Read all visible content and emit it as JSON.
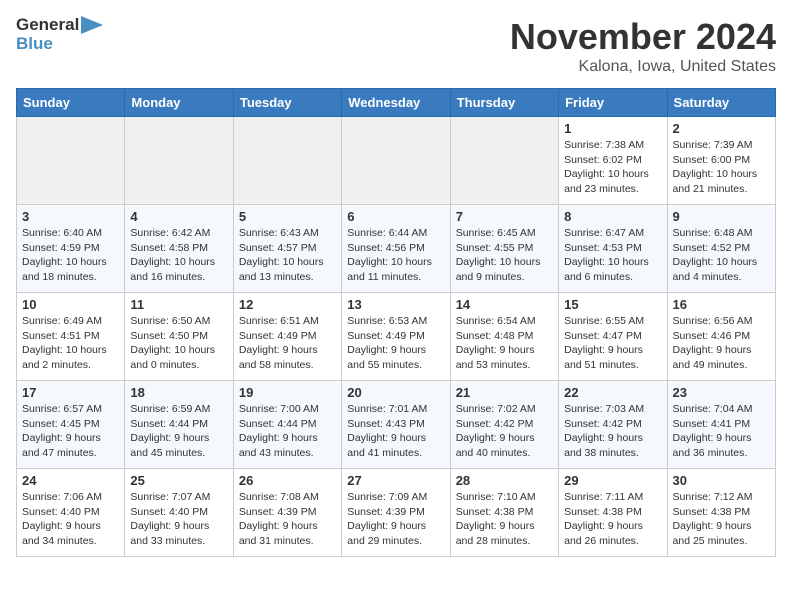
{
  "logo": {
    "line1": "General",
    "line2": "Blue"
  },
  "title": "November 2024",
  "subtitle": "Kalona, Iowa, United States",
  "days_of_week": [
    "Sunday",
    "Monday",
    "Tuesday",
    "Wednesday",
    "Thursday",
    "Friday",
    "Saturday"
  ],
  "weeks": [
    [
      {
        "day": "",
        "info": ""
      },
      {
        "day": "",
        "info": ""
      },
      {
        "day": "",
        "info": ""
      },
      {
        "day": "",
        "info": ""
      },
      {
        "day": "",
        "info": ""
      },
      {
        "day": "1",
        "info": "Sunrise: 7:38 AM\nSunset: 6:02 PM\nDaylight: 10 hours and 23 minutes."
      },
      {
        "day": "2",
        "info": "Sunrise: 7:39 AM\nSunset: 6:00 PM\nDaylight: 10 hours and 21 minutes."
      }
    ],
    [
      {
        "day": "3",
        "info": "Sunrise: 6:40 AM\nSunset: 4:59 PM\nDaylight: 10 hours and 18 minutes."
      },
      {
        "day": "4",
        "info": "Sunrise: 6:42 AM\nSunset: 4:58 PM\nDaylight: 10 hours and 16 minutes."
      },
      {
        "day": "5",
        "info": "Sunrise: 6:43 AM\nSunset: 4:57 PM\nDaylight: 10 hours and 13 minutes."
      },
      {
        "day": "6",
        "info": "Sunrise: 6:44 AM\nSunset: 4:56 PM\nDaylight: 10 hours and 11 minutes."
      },
      {
        "day": "7",
        "info": "Sunrise: 6:45 AM\nSunset: 4:55 PM\nDaylight: 10 hours and 9 minutes."
      },
      {
        "day": "8",
        "info": "Sunrise: 6:47 AM\nSunset: 4:53 PM\nDaylight: 10 hours and 6 minutes."
      },
      {
        "day": "9",
        "info": "Sunrise: 6:48 AM\nSunset: 4:52 PM\nDaylight: 10 hours and 4 minutes."
      }
    ],
    [
      {
        "day": "10",
        "info": "Sunrise: 6:49 AM\nSunset: 4:51 PM\nDaylight: 10 hours and 2 minutes."
      },
      {
        "day": "11",
        "info": "Sunrise: 6:50 AM\nSunset: 4:50 PM\nDaylight: 10 hours and 0 minutes."
      },
      {
        "day": "12",
        "info": "Sunrise: 6:51 AM\nSunset: 4:49 PM\nDaylight: 9 hours and 58 minutes."
      },
      {
        "day": "13",
        "info": "Sunrise: 6:53 AM\nSunset: 4:49 PM\nDaylight: 9 hours and 55 minutes."
      },
      {
        "day": "14",
        "info": "Sunrise: 6:54 AM\nSunset: 4:48 PM\nDaylight: 9 hours and 53 minutes."
      },
      {
        "day": "15",
        "info": "Sunrise: 6:55 AM\nSunset: 4:47 PM\nDaylight: 9 hours and 51 minutes."
      },
      {
        "day": "16",
        "info": "Sunrise: 6:56 AM\nSunset: 4:46 PM\nDaylight: 9 hours and 49 minutes."
      }
    ],
    [
      {
        "day": "17",
        "info": "Sunrise: 6:57 AM\nSunset: 4:45 PM\nDaylight: 9 hours and 47 minutes."
      },
      {
        "day": "18",
        "info": "Sunrise: 6:59 AM\nSunset: 4:44 PM\nDaylight: 9 hours and 45 minutes."
      },
      {
        "day": "19",
        "info": "Sunrise: 7:00 AM\nSunset: 4:44 PM\nDaylight: 9 hours and 43 minutes."
      },
      {
        "day": "20",
        "info": "Sunrise: 7:01 AM\nSunset: 4:43 PM\nDaylight: 9 hours and 41 minutes."
      },
      {
        "day": "21",
        "info": "Sunrise: 7:02 AM\nSunset: 4:42 PM\nDaylight: 9 hours and 40 minutes."
      },
      {
        "day": "22",
        "info": "Sunrise: 7:03 AM\nSunset: 4:42 PM\nDaylight: 9 hours and 38 minutes."
      },
      {
        "day": "23",
        "info": "Sunrise: 7:04 AM\nSunset: 4:41 PM\nDaylight: 9 hours and 36 minutes."
      }
    ],
    [
      {
        "day": "24",
        "info": "Sunrise: 7:06 AM\nSunset: 4:40 PM\nDaylight: 9 hours and 34 minutes."
      },
      {
        "day": "25",
        "info": "Sunrise: 7:07 AM\nSunset: 4:40 PM\nDaylight: 9 hours and 33 minutes."
      },
      {
        "day": "26",
        "info": "Sunrise: 7:08 AM\nSunset: 4:39 PM\nDaylight: 9 hours and 31 minutes."
      },
      {
        "day": "27",
        "info": "Sunrise: 7:09 AM\nSunset: 4:39 PM\nDaylight: 9 hours and 29 minutes."
      },
      {
        "day": "28",
        "info": "Sunrise: 7:10 AM\nSunset: 4:38 PM\nDaylight: 9 hours and 28 minutes."
      },
      {
        "day": "29",
        "info": "Sunrise: 7:11 AM\nSunset: 4:38 PM\nDaylight: 9 hours and 26 minutes."
      },
      {
        "day": "30",
        "info": "Sunrise: 7:12 AM\nSunset: 4:38 PM\nDaylight: 9 hours and 25 minutes."
      }
    ]
  ]
}
